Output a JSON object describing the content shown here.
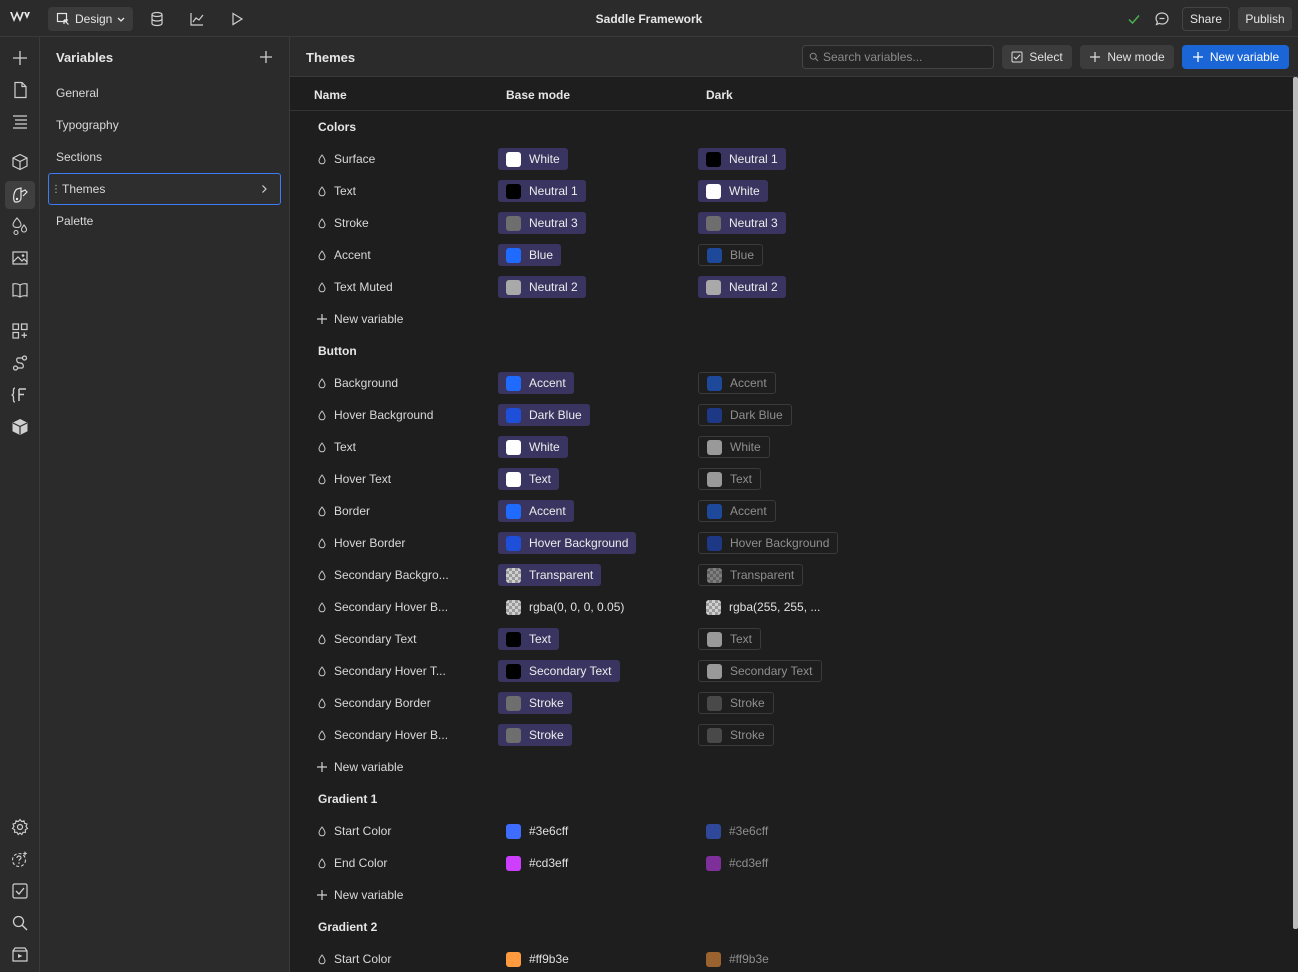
{
  "topbar": {
    "design_label": "Design",
    "app_title": "Saddle Framework",
    "share_label": "Share",
    "publish_label": "Publish"
  },
  "panel": {
    "title": "Variables",
    "collections": [
      "General",
      "Typography",
      "Sections",
      "Themes",
      "Palette"
    ],
    "selected": "Themes"
  },
  "main": {
    "title": "Themes",
    "search_placeholder": "Search variables...",
    "select_label": "Select",
    "new_mode_label": "New mode",
    "new_variable_label": "New variable",
    "columns": [
      "Name",
      "Base mode",
      "Dark"
    ]
  },
  "colors": {
    "accent": "#1b66d6",
    "alias_chip": "#3a3560",
    "selection_border": "#3d7cf5"
  },
  "rows": [
    {
      "type": "group",
      "label": "Colors"
    },
    {
      "type": "var",
      "name": "Surface",
      "base": {
        "kind": "alias",
        "label": "White",
        "color": "#ffffff"
      },
      "dark": {
        "kind": "alias",
        "label": "Neutral 1",
        "color": "#000000"
      }
    },
    {
      "type": "var",
      "name": "Text",
      "base": {
        "kind": "alias",
        "label": "Neutral 1",
        "color": "#000000"
      },
      "dark": {
        "kind": "alias",
        "label": "White",
        "color": "#ffffff"
      }
    },
    {
      "type": "var",
      "name": "Stroke",
      "base": {
        "kind": "alias",
        "label": "Neutral 3",
        "color": "#6e6e6e"
      },
      "dark": {
        "kind": "alias",
        "label": "Neutral 3",
        "color": "#6e6e6e"
      }
    },
    {
      "type": "var",
      "name": "Accent",
      "base": {
        "kind": "alias",
        "label": "Blue",
        "color": "#1f6bff"
      },
      "dark": {
        "kind": "alias-inherit",
        "label": "Blue",
        "color": "#1f6bff"
      }
    },
    {
      "type": "var",
      "name": "Text Muted",
      "base": {
        "kind": "alias",
        "label": "Neutral 2",
        "color": "#a9a9a9"
      },
      "dark": {
        "kind": "alias",
        "label": "Neutral 2",
        "color": "#a9a9a9"
      }
    },
    {
      "type": "new",
      "label": "New variable"
    },
    {
      "type": "group",
      "label": "Button"
    },
    {
      "type": "var",
      "name": "Background",
      "base": {
        "kind": "alias",
        "label": "Accent",
        "color": "#1f6bff"
      },
      "dark": {
        "kind": "alias-inherit",
        "label": "Accent",
        "color": "#1f6bff"
      }
    },
    {
      "type": "var",
      "name": "Hover Background",
      "base": {
        "kind": "alias",
        "label": "Dark Blue",
        "color": "#1d4fd8"
      },
      "dark": {
        "kind": "alias-inherit",
        "label": "Dark Blue",
        "color": "#1d4fd8"
      }
    },
    {
      "type": "var",
      "name": "Text",
      "base": {
        "kind": "alias",
        "label": "White",
        "color": "#ffffff"
      },
      "dark": {
        "kind": "alias-inherit",
        "label": "White",
        "color": "#ffffff"
      }
    },
    {
      "type": "var",
      "name": "Hover Text",
      "base": {
        "kind": "alias",
        "label": "Text",
        "color": "#ffffff"
      },
      "dark": {
        "kind": "alias-inherit",
        "label": "Text",
        "color": "#ffffff"
      }
    },
    {
      "type": "var",
      "name": "Border",
      "base": {
        "kind": "alias",
        "label": "Accent",
        "color": "#1f6bff"
      },
      "dark": {
        "kind": "alias-inherit",
        "label": "Accent",
        "color": "#1f6bff"
      }
    },
    {
      "type": "var",
      "name": "Hover Border",
      "base": {
        "kind": "alias",
        "label": "Hover Background",
        "color": "#1d4fd8"
      },
      "dark": {
        "kind": "alias-inherit",
        "label": "Hover Background",
        "color": "#1d4fd8"
      }
    },
    {
      "type": "var",
      "name": "Secondary Backgro...",
      "base": {
        "kind": "alias",
        "label": "Transparent",
        "color": "checker"
      },
      "dark": {
        "kind": "alias-inherit",
        "label": "Transparent",
        "color": "checker"
      }
    },
    {
      "type": "var",
      "name": "Secondary Hover B...",
      "base": {
        "kind": "raw",
        "label": "rgba(0, 0, 0, 0.05)",
        "color": "checker"
      },
      "dark": {
        "kind": "raw",
        "label": "rgba(255, 255, ...",
        "color": "checker"
      }
    },
    {
      "type": "var",
      "name": "Secondary Text",
      "base": {
        "kind": "alias",
        "label": "Text",
        "color": "#000000"
      },
      "dark": {
        "kind": "alias-inherit",
        "label": "Text",
        "color": "#ffffff"
      }
    },
    {
      "type": "var",
      "name": "Secondary Hover T...",
      "base": {
        "kind": "alias",
        "label": "Secondary Text",
        "color": "#000000"
      },
      "dark": {
        "kind": "alias-inherit",
        "label": "Secondary Text",
        "color": "#ffffff"
      }
    },
    {
      "type": "var",
      "name": "Secondary Border",
      "base": {
        "kind": "alias",
        "label": "Stroke",
        "color": "#6e6e6e"
      },
      "dark": {
        "kind": "alias-inherit",
        "label": "Stroke",
        "color": "#6e6e6e"
      }
    },
    {
      "type": "var",
      "name": "Secondary Hover B...",
      "base": {
        "kind": "alias",
        "label": "Stroke",
        "color": "#6e6e6e"
      },
      "dark": {
        "kind": "alias-inherit",
        "label": "Stroke",
        "color": "#6e6e6e"
      }
    },
    {
      "type": "new",
      "label": "New variable"
    },
    {
      "type": "group",
      "label": "Gradient 1"
    },
    {
      "type": "var",
      "name": "Start Color",
      "base": {
        "kind": "raw",
        "label": "#3e6cff",
        "color": "#3e6cff"
      },
      "dark": {
        "kind": "raw-inherit",
        "label": "#3e6cff",
        "color": "#3e6cff"
      }
    },
    {
      "type": "var",
      "name": "End Color",
      "base": {
        "kind": "raw",
        "label": "#cd3eff",
        "color": "#cd3eff"
      },
      "dark": {
        "kind": "raw-inherit",
        "label": "#cd3eff",
        "color": "#cd3eff"
      }
    },
    {
      "type": "new",
      "label": "New variable"
    },
    {
      "type": "group",
      "label": "Gradient 2"
    },
    {
      "type": "var",
      "name": "Start Color",
      "base": {
        "kind": "raw",
        "label": "#ff9b3e",
        "color": "#ff9b3e"
      },
      "dark": {
        "kind": "raw-inherit",
        "label": "#ff9b3e",
        "color": "#ff9b3e"
      }
    }
  ]
}
